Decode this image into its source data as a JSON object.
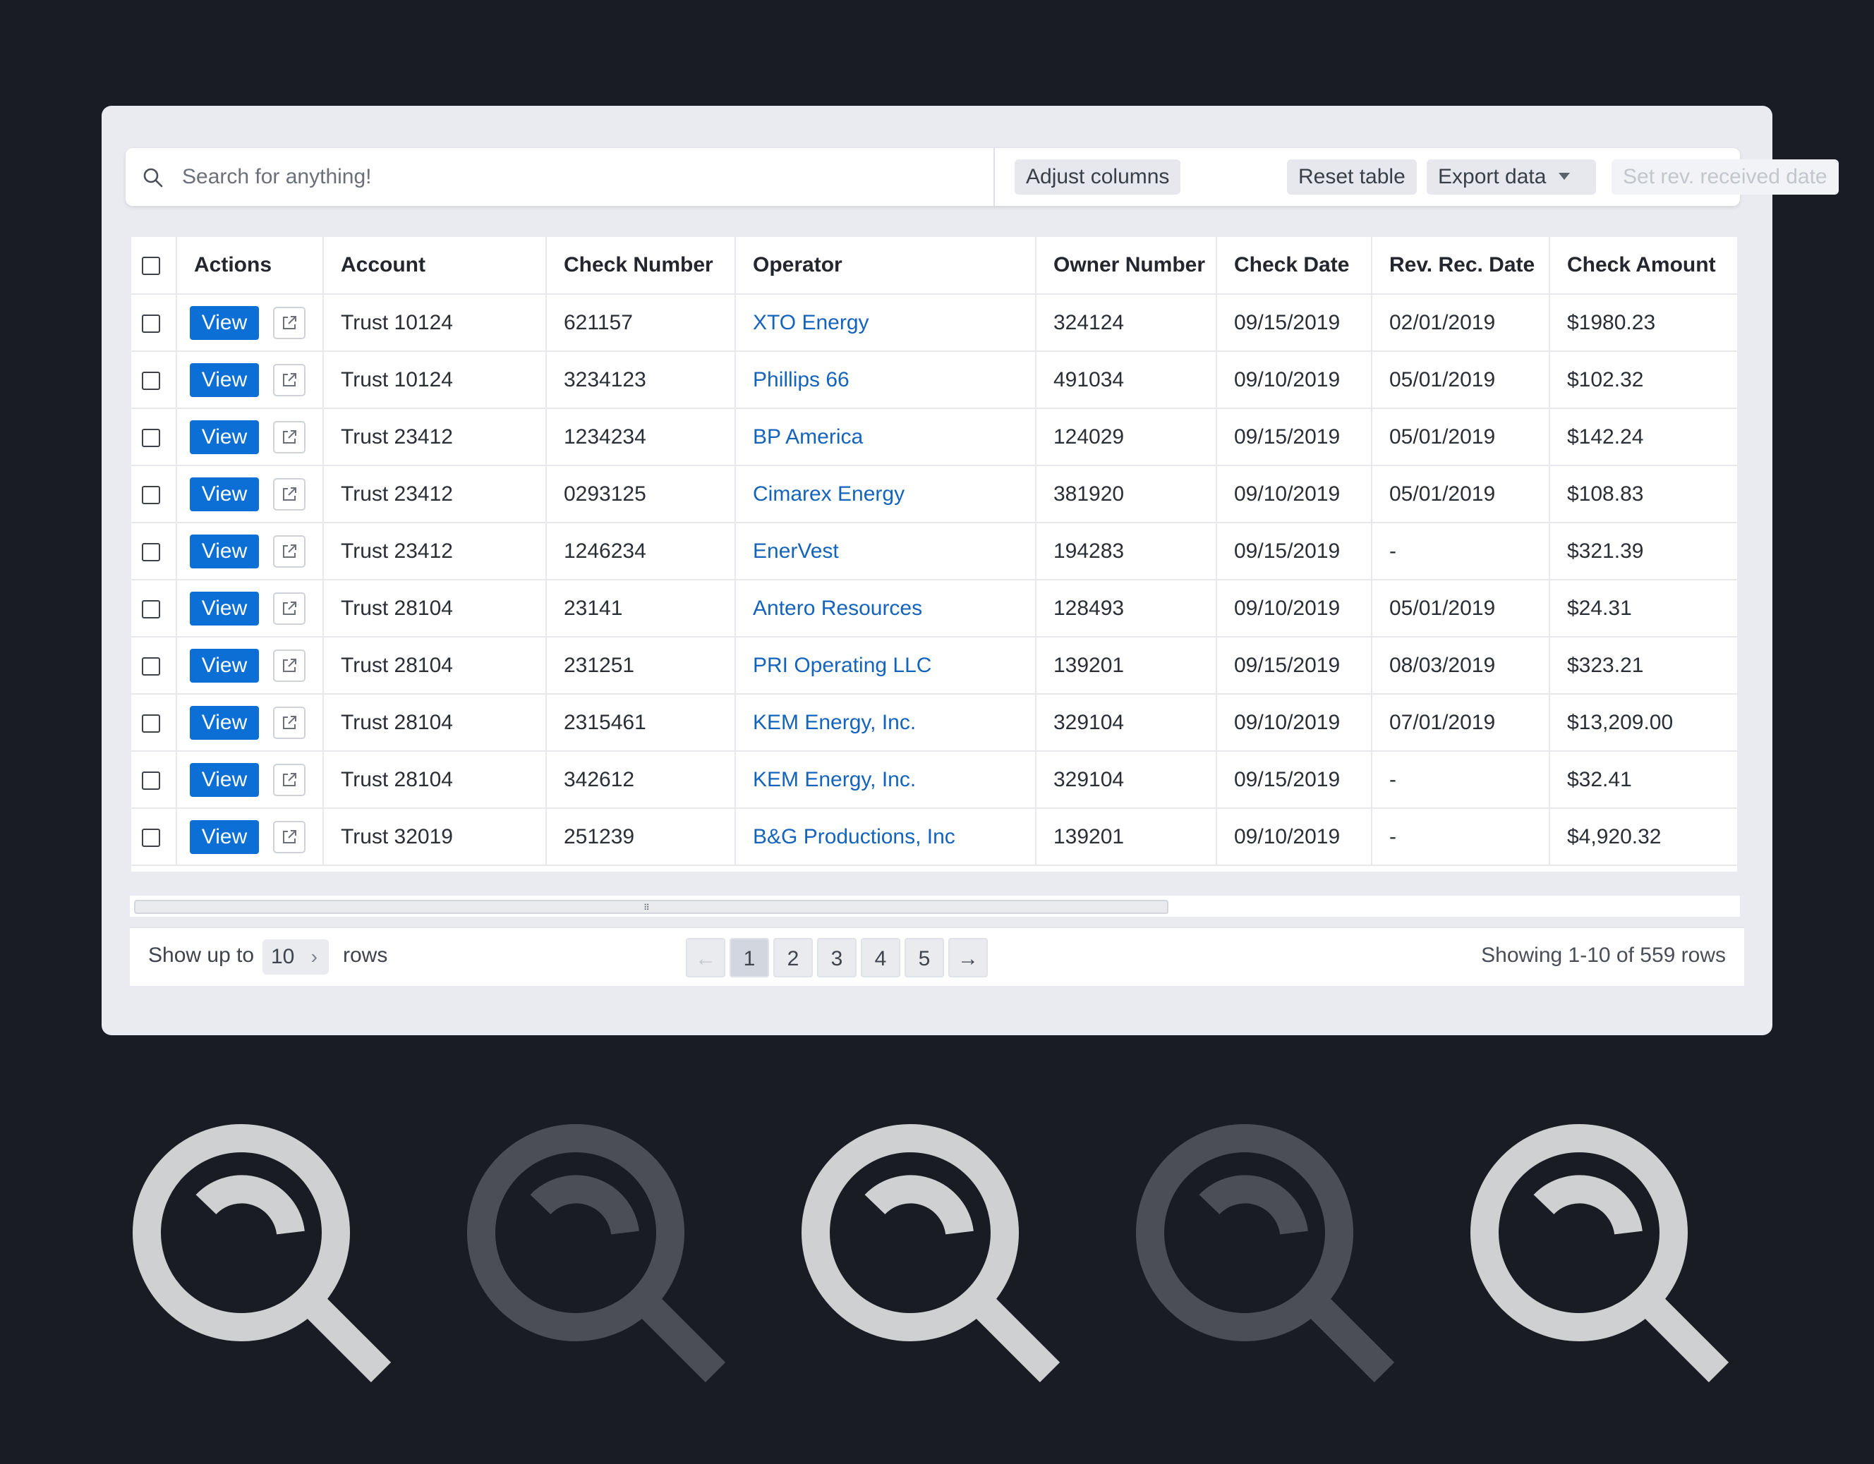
{
  "toolbar": {
    "search_placeholder": "Search for anything!",
    "adjust_columns": "Adjust columns",
    "reset_table": "Reset table",
    "export_data": "Export data",
    "set_rev_received_date": "Set rev. received date"
  },
  "table": {
    "headers": {
      "actions": "Actions",
      "account": "Account",
      "check_number": "Check Number",
      "operator": "Operator",
      "owner_number": "Owner Number",
      "check_date": "Check Date",
      "rev_rec_date": "Rev. Rec. Date",
      "check_amount": "Check Amount"
    },
    "view_label": "View",
    "rows": [
      {
        "account": "Trust 10124",
        "check_number": "621157",
        "operator": "XTO Energy",
        "owner_number": "324124",
        "check_date": "09/15/2019",
        "rev_rec_date": "02/01/2019",
        "check_amount": "$1980.23"
      },
      {
        "account": "Trust 10124",
        "check_number": "3234123",
        "operator": "Phillips 66",
        "owner_number": "491034",
        "check_date": "09/10/2019",
        "rev_rec_date": "05/01/2019",
        "check_amount": "$102.32"
      },
      {
        "account": "Trust 23412",
        "check_number": "1234234",
        "operator": "BP America",
        "owner_number": "124029",
        "check_date": "09/15/2019",
        "rev_rec_date": "05/01/2019",
        "check_amount": "$142.24"
      },
      {
        "account": "Trust 23412",
        "check_number": "0293125",
        "operator": "Cimarex Energy",
        "owner_number": "381920",
        "check_date": "09/10/2019",
        "rev_rec_date": "05/01/2019",
        "check_amount": "$108.83"
      },
      {
        "account": "Trust 23412",
        "check_number": "1246234",
        "operator": "EnerVest",
        "owner_number": "194283",
        "check_date": "09/15/2019",
        "rev_rec_date": "-",
        "check_amount": "$321.39"
      },
      {
        "account": "Trust 28104",
        "check_number": "23141",
        "operator": "Antero Resources",
        "owner_number": "128493",
        "check_date": "09/10/2019",
        "rev_rec_date": "05/01/2019",
        "check_amount": "$24.31"
      },
      {
        "account": "Trust 28104",
        "check_number": "231251",
        "operator": "PRI Operating LLC",
        "owner_number": "139201",
        "check_date": "09/15/2019",
        "rev_rec_date": "08/03/2019",
        "check_amount": "$323.21"
      },
      {
        "account": "Trust 28104",
        "check_number": "2315461",
        "operator": "KEM Energy, Inc.",
        "owner_number": "329104",
        "check_date": "09/10/2019",
        "rev_rec_date": "07/01/2019",
        "check_amount": "$13,209.00"
      },
      {
        "account": "Trust 28104",
        "check_number": "342612",
        "operator": "KEM Energy, Inc.",
        "owner_number": "329104",
        "check_date": "09/15/2019",
        "rev_rec_date": "-",
        "check_amount": "$32.41"
      },
      {
        "account": "Trust 32019",
        "check_number": "251239",
        "operator": "B&G Productions, Inc",
        "owner_number": "139201",
        "check_date": "09/10/2019",
        "rev_rec_date": "-",
        "check_amount": "$4,920.32"
      }
    ]
  },
  "footer": {
    "show_up_to": "Show up to",
    "rows_value": "10",
    "rows_label": "rows",
    "pages": [
      "1",
      "2",
      "3",
      "4",
      "5"
    ],
    "prev_arrow": "←",
    "next_arrow": "→",
    "showing": "Showing 1-10 of 559 rows"
  },
  "colors": {
    "background": "#191d23",
    "panel": "#e9ebf0",
    "accent": "#0b6fd6",
    "link": "#1464bd",
    "icon_light": "#cfd0d2",
    "icon_dark": "#4b4f55"
  },
  "icons": [
    "search-icon",
    "external-link-icon",
    "chevron-right-icon",
    "caret-down-icon"
  ]
}
